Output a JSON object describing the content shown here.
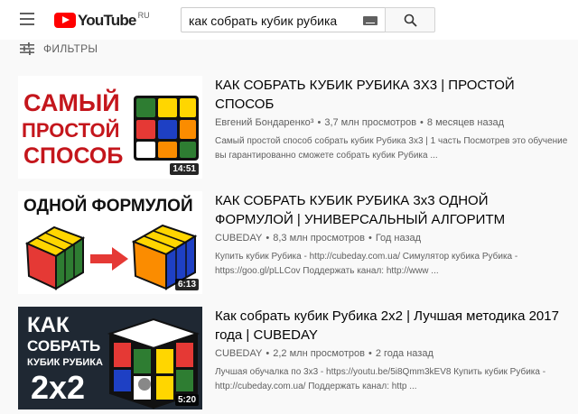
{
  "header": {
    "logo_text": "YouTube",
    "logo_region": "RU",
    "search_value": "как собрать кубик рубика"
  },
  "filters": {
    "label": "ФИЛЬТРЫ"
  },
  "videos": [
    {
      "title": "КАК СОБРАТЬ КУБИК РУБИКА 3Х3 | ПРОСТОЙ СПОСОБ",
      "channel": "Евгений Бондаренко³",
      "views": "3,7 млн просмотров",
      "age": "8 месяцев назад",
      "description": "Самый простой способ собрать кубик Рубика 3х3 | 1 часть Посмотрев это обучение вы гарантированно сможете собрать кубик Рубика ...",
      "duration": "14:51",
      "thumb_text_line1": "САМЫЙ",
      "thumb_text_line2": "ПРОСТОЙ",
      "thumb_text_line3": "СПОСОБ"
    },
    {
      "title": "КАК СОБРАТЬ КУБИК РУБИКА 3х3 ОДНОЙ ФОРМУЛОЙ | УНИВЕРСАЛЬНЫЙ АЛГОРИТМ",
      "channel": "CUBEDAY",
      "views": "8,3 млн просмотров",
      "age": "Год назад",
      "description": "Купить кубик Рубика - http://cubeday.com.ua/ Симулятор кубика Рубика - https://goo.gl/pLLCov Поддержать канал: http://www ...",
      "duration": "6:13",
      "thumb_text_line1": "ОДНОЙ ФОРМУЛОЙ"
    },
    {
      "title": "Как собрать кубик Рубика 2х2 | Лучшая методика 2017 года | CUBEDAY",
      "channel": "CUBEDAY",
      "views": "2,2 млн просмотров",
      "age": "2 года назад",
      "description": "Лучшая обучалка по 3х3 - https://youtu.be/5i8Qmm3kEV8 Купить кубик Рубика - http://cubeday.com.ua/ Поддержать канал: http ...",
      "duration": "5:20",
      "thumb_text_line1": "КАК",
      "thumb_text_line2": "СОБРАТЬ",
      "thumb_text_line3": "КУБИК РУБИКА",
      "thumb_text_line4": "2x2"
    }
  ],
  "colors": {
    "accent": "#ff0000",
    "thumb1_text": "#c4161c",
    "thumb3_bg": "#1f2833"
  }
}
